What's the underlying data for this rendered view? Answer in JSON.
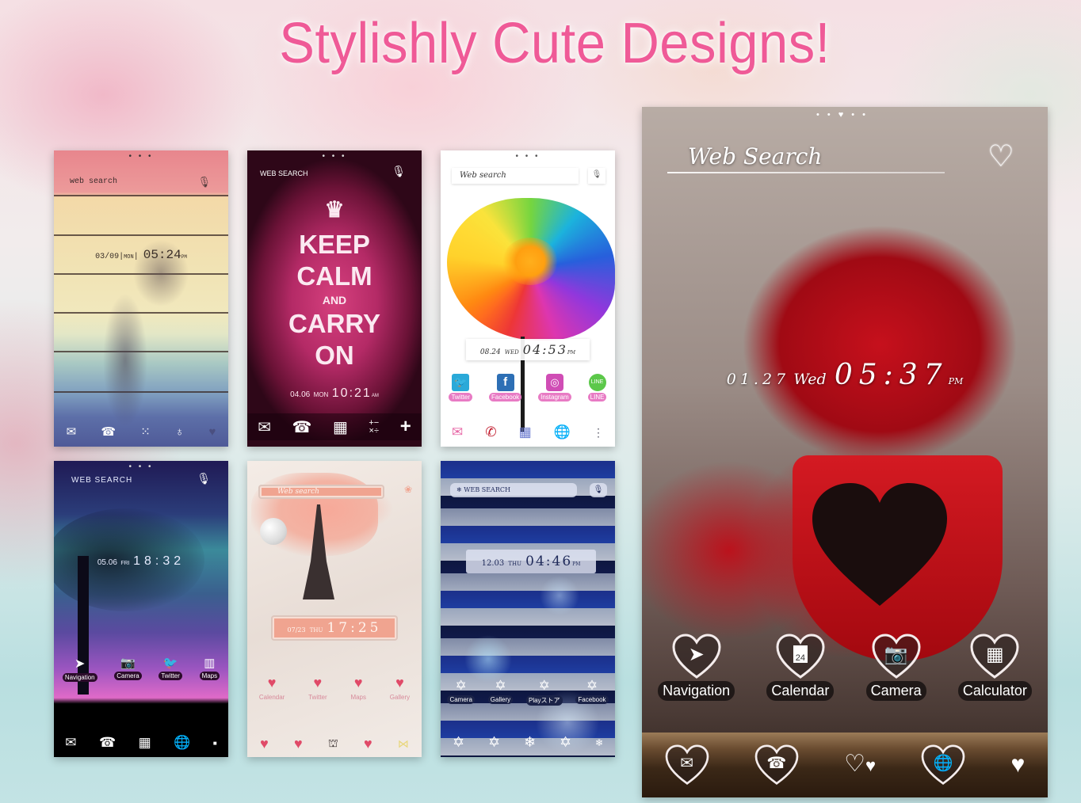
{
  "headline": "Stylishly Cute Designs!",
  "colors": {
    "headline": "#ef5a97",
    "background_top": "#f5e0e4",
    "background_bottom": "#b9dfe0"
  },
  "themes": [
    {
      "name": "rainbow-wood",
      "page_dots": "• • •",
      "search_label": "web search",
      "search_icon": "mic-icon",
      "date": "03/09",
      "day": "MON",
      "time": "05:24",
      "ampm": "PM",
      "dock_icons": [
        "mail-icon",
        "phone-icon",
        "apps-icon",
        "browser-icon",
        "heart-icon"
      ]
    },
    {
      "name": "keep-calm",
      "page_dots": "• • •",
      "search_label": "WEB SEARCH",
      "search_icon": "mic-icon",
      "poster": [
        "KEEP",
        "CALM",
        "AND",
        "CARRY",
        "ON"
      ],
      "date": "04.06",
      "day": "MON",
      "time": "10:21",
      "ampm": "AM",
      "dock_icons": [
        "mail-icon",
        "phone-icon",
        "apps-icon",
        "calculator-icon",
        "plus-icon"
      ]
    },
    {
      "name": "rainbow-rose",
      "page_dots": "• • •",
      "search_label": "Web search",
      "search_icon": "mic-icon",
      "date": "08.24",
      "day": "WED",
      "time": "04:53",
      "ampm": "PM",
      "apps": [
        {
          "label": "Twitter",
          "icon": "twitter-icon",
          "color": "#2aa9d8"
        },
        {
          "label": "Facebook",
          "icon": "facebook-icon",
          "color": "#2d6fb5"
        },
        {
          "label": "Instagram",
          "icon": "instagram-icon",
          "color": "#d04db5"
        },
        {
          "label": "LINE",
          "icon": "line-icon",
          "color": "#5cc84a"
        }
      ],
      "dock_icons": [
        "mail-icon",
        "phone-icon",
        "apps-icon",
        "globe-icon",
        "menu-icon"
      ]
    },
    {
      "name": "night-tree",
      "page_dots": "• • •",
      "search_label": "WEB SEARCH",
      "search_icon": "mic-icon",
      "date": "05.06",
      "day": "FRI",
      "time": "18:32",
      "apps": [
        {
          "label": "Navigation",
          "icon": "navigation-icon"
        },
        {
          "label": "Camera",
          "icon": "camera-icon"
        },
        {
          "label": "Twitter",
          "icon": "twitter-icon"
        },
        {
          "label": "Maps",
          "icon": "map-icon"
        }
      ],
      "dock_icons": [
        "mail-icon",
        "phone-icon",
        "apps-icon",
        "globe-icon",
        "square-icon"
      ]
    },
    {
      "name": "eiffel-lace",
      "search_label": "Web search",
      "date": "07/23",
      "day": "THU",
      "time": "17:25",
      "apps": [
        {
          "label": "Calendar",
          "icon": "calendar-icon"
        },
        {
          "label": "Twitter",
          "icon": "twitter-icon"
        },
        {
          "label": "Maps",
          "icon": "map-icon"
        },
        {
          "label": "Gallery",
          "icon": "gallery-icon"
        }
      ],
      "dock_icons": [
        "mail-icon",
        "phone-icon",
        "eiffel-icon",
        "globe-icon",
        "bow-icon"
      ]
    },
    {
      "name": "snow-chevron",
      "search_label": "WEB SEARCH",
      "search_icon": "mic-icon",
      "date": "12.03",
      "day": "THU",
      "time": "04:46",
      "ampm": "PM",
      "apps": [
        {
          "label": "Camera",
          "icon": "camera-icon"
        },
        {
          "label": "Gallery",
          "icon": "gallery-icon"
        },
        {
          "label": "Playストア",
          "icon": "play-store-icon"
        },
        {
          "label": "Facebook",
          "icon": "facebook-icon"
        }
      ],
      "dock_icons": [
        "mail-icon",
        "phone-icon",
        "snowflake-icon",
        "globe-icon",
        "snowflake-small-icon"
      ]
    },
    {
      "name": "red-roses",
      "page_dots": [
        "•",
        "•",
        "♥",
        "•",
        "•"
      ],
      "search_label": "Web Search",
      "search_icon": "heart-icon",
      "date": "01.27",
      "day": "Wed",
      "time": "05:37",
      "ampm": "PM",
      "apps": [
        {
          "label": "Navigation",
          "icon": "navigation-icon"
        },
        {
          "label": "Calendar",
          "icon": "calendar-icon",
          "badge": "24"
        },
        {
          "label": "Camera",
          "icon": "camera-icon"
        },
        {
          "label": "Calculator",
          "icon": "calculator-icon"
        }
      ],
      "dock_icons": [
        "mail-icon",
        "phone-icon",
        "hearts-icon",
        "globe-icon",
        "heart-icon"
      ]
    }
  ]
}
